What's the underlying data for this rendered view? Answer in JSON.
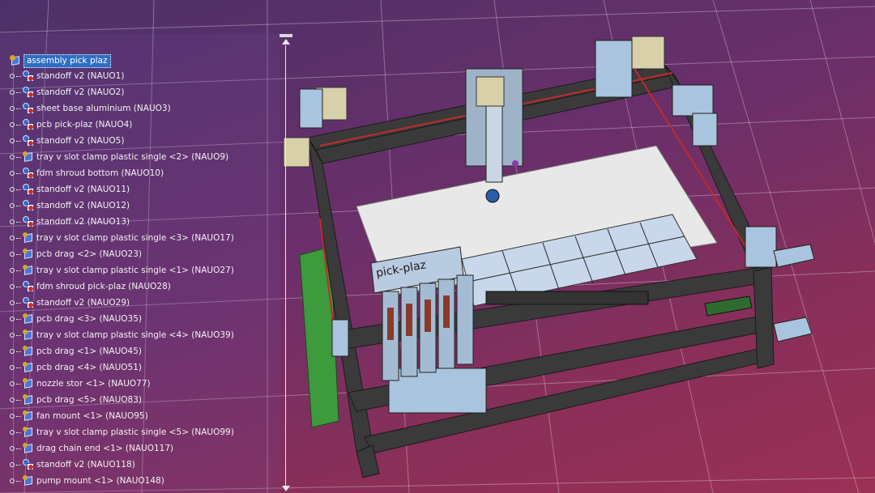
{
  "colors": {
    "background_top": "#4c3168",
    "background_bottom": "#9b3055",
    "selection": "#2f6ec4",
    "tree_text": "#f2f2f2"
  },
  "tree": {
    "root": {
      "label": "assembly pick plaz",
      "icon": "product-assembly-icon",
      "selected": true
    },
    "items": [
      {
        "label": "standoff v2 (NAUO1)",
        "icon": "part-icon"
      },
      {
        "label": "standoff v2 (NAUO2)",
        "icon": "part-icon"
      },
      {
        "label": "sheet base aluminium (NAUO3)",
        "icon": "part-icon"
      },
      {
        "label": "pcb pick-plaz (NAUO4)",
        "icon": "part-icon"
      },
      {
        "label": "standoff v2 (NAUO5)",
        "icon": "part-icon"
      },
      {
        "label": "tray v slot clamp plastic single <2> (NAUO9)",
        "icon": "product-icon"
      },
      {
        "label": "fdm shroud bottom (NAUO10)",
        "icon": "part-icon"
      },
      {
        "label": "standoff v2 (NAUO11)",
        "icon": "part-icon"
      },
      {
        "label": "standoff v2 (NAUO12)",
        "icon": "part-icon"
      },
      {
        "label": "standoff v2 (NAUO13)",
        "icon": "part-icon"
      },
      {
        "label": "tray v slot clamp plastic single <3> (NAUO17)",
        "icon": "product-icon"
      },
      {
        "label": "pcb drag <2> (NAUO23)",
        "icon": "product-icon"
      },
      {
        "label": "tray v slot clamp plastic single <1> (NAUO27)",
        "icon": "product-icon"
      },
      {
        "label": "fdm shroud pick-plaz (NAUO28)",
        "icon": "part-icon"
      },
      {
        "label": "standoff v2 (NAUO29)",
        "icon": "part-icon"
      },
      {
        "label": "pcb drag <3> (NAUO35)",
        "icon": "product-icon"
      },
      {
        "label": "tray v slot clamp plastic single <4> (NAUO39)",
        "icon": "product-icon"
      },
      {
        "label": "pcb drag <1> (NAUO45)",
        "icon": "product-icon"
      },
      {
        "label": "pcb drag <4> (NAUO51)",
        "icon": "product-icon"
      },
      {
        "label": "nozzle stor <1> (NAUO77)",
        "icon": "product-icon"
      },
      {
        "label": "pcb drag <5> (NAUO83)",
        "icon": "product-icon"
      },
      {
        "label": "fan mount <1> (NAUO95)",
        "icon": "product-icon"
      },
      {
        "label": "tray v slot clamp plastic single <5> (NAUO99)",
        "icon": "product-icon"
      },
      {
        "label": "drag chain end <1> (NAUO117)",
        "icon": "product-icon"
      },
      {
        "label": "standoff v2 (NAUO118)",
        "icon": "part-icon"
      },
      {
        "label": "pump mount <1> (NAUO148)",
        "icon": "product-icon"
      }
    ]
  },
  "model": {
    "engraved_text": "pick-plaz",
    "icon": "pick-and-place-machine-model"
  }
}
